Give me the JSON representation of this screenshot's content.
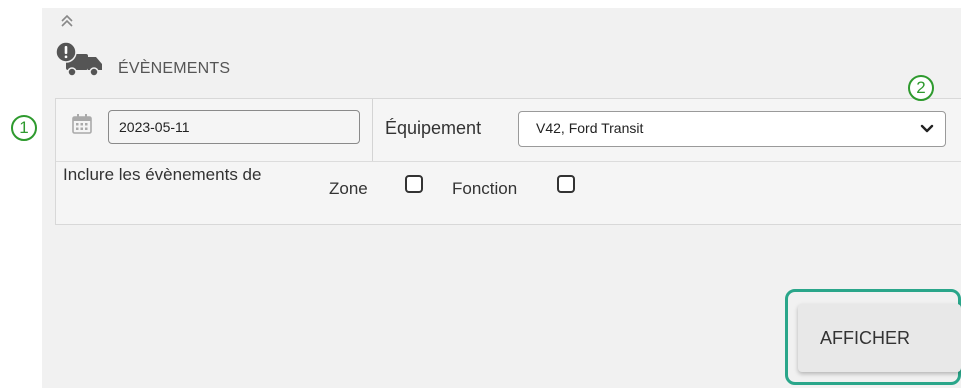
{
  "section": {
    "title": "ÉVÈNEMENTS",
    "collapse_icon": "double-chevron-up-icon",
    "section_icon": "truck-alert-icon"
  },
  "date": {
    "icon": "calendar-icon",
    "value": "2023-05-11"
  },
  "equipment": {
    "label": "Équipement",
    "selected": "V42, Ford Transit",
    "icon": "chevron-down-icon"
  },
  "include": {
    "label": "Inclure les évènements de",
    "zone_label": "Zone",
    "zone_checked": false,
    "fonction_label": "Fonction",
    "fonction_checked": false
  },
  "callouts": {
    "one": "1",
    "two": "2",
    "color": "#2e9a2e"
  },
  "actions": {
    "show_label": "AFFICHER",
    "highlight_color": "#2aa68a"
  }
}
